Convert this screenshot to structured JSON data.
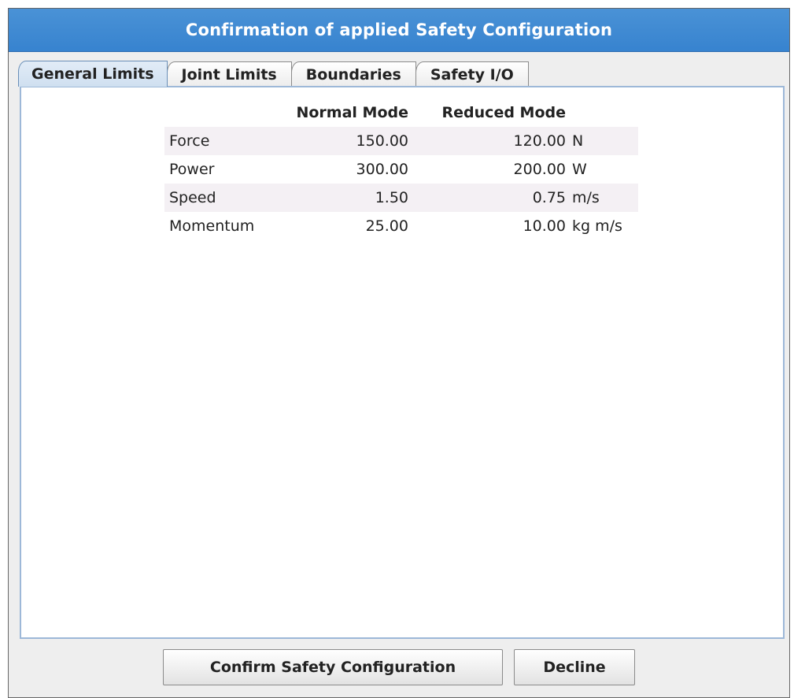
{
  "dialog": {
    "title": "Confirmation of applied Safety Configuration"
  },
  "tabs": [
    {
      "label": "General Limits",
      "active": true
    },
    {
      "label": "Joint Limits",
      "active": false
    },
    {
      "label": "Boundaries",
      "active": false
    },
    {
      "label": "Safety I/O",
      "active": false
    }
  ],
  "limits_table": {
    "headers": {
      "normal": "Normal Mode",
      "reduced": "Reduced Mode"
    },
    "rows": [
      {
        "label": "Force",
        "normal": "150.00",
        "reduced": "120.00",
        "unit": "N"
      },
      {
        "label": "Power",
        "normal": "300.00",
        "reduced": "200.00",
        "unit": "W"
      },
      {
        "label": "Speed",
        "normal": "1.50",
        "reduced": "0.75",
        "unit": "m/s"
      },
      {
        "label": "Momentum",
        "normal": "25.00",
        "reduced": "10.00",
        "unit": "kg m/s"
      }
    ]
  },
  "buttons": {
    "confirm_label": "Confirm Safety Configuration",
    "decline_label": "Decline"
  },
  "colors": {
    "title_bar": "#3783cf",
    "title_text": "#ffffff",
    "row_shade": "#f4f0f4",
    "panel_border": "#9db8d8"
  }
}
